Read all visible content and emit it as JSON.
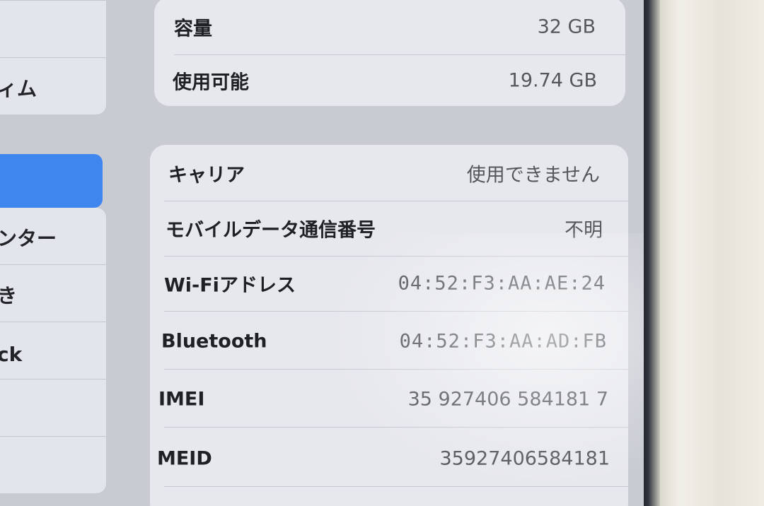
{
  "sidebar": {
    "items": [
      {
        "label": ""
      },
      {
        "label": "ィム"
      },
      {
        "label": ""
      },
      {
        "label": "ンター"
      },
      {
        "label": "き"
      },
      {
        "label": "ck"
      },
      {
        "label": ""
      },
      {
        "label": ""
      }
    ]
  },
  "storage": {
    "rows": [
      {
        "label": "容量",
        "value": "32 GB"
      },
      {
        "label": "使用可能",
        "value": "19.74 GB"
      }
    ]
  },
  "network": {
    "rows": [
      {
        "label": "キャリア",
        "value": "使用できません"
      },
      {
        "label": "モバイルデータ通信番号",
        "value": "不明"
      },
      {
        "label": "Wi-Fiアドレス",
        "value": "04:52:F3:AA:AE:24"
      },
      {
        "label": "Bluetooth",
        "value": "04:52:F3:AA:AD:FB"
      },
      {
        "label": "IMEI",
        "value": "35 927406 584181 7"
      },
      {
        "label": "MEID",
        "value": "35927406584181"
      }
    ]
  },
  "colors": {
    "selected_accent": "#3f86ee",
    "card_background": "#e7e8ed",
    "screen_background": "#c9cbd3"
  }
}
